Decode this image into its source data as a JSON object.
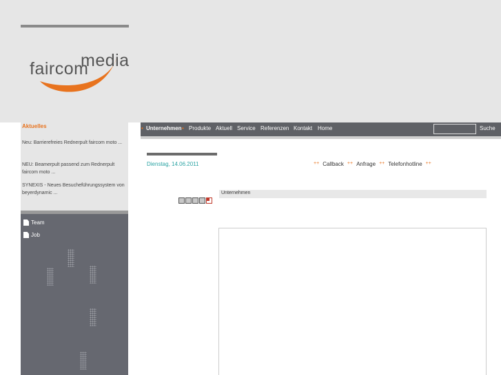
{
  "logo": {
    "line1": "media",
    "line2": "faircom",
    "accent_color": "#e8731e"
  },
  "news": {
    "title": "Aktuelles",
    "items": [
      "Neu: Barrierefreies Rednerpult faircom moto ...",
      "NEU: Beamerpult passend zum Rednerpult faircom moto ...",
      "SYNEXIS - Neues Besucheführungssystem von beyerdynamic ..."
    ]
  },
  "side_nav": [
    {
      "label": "Team",
      "icon": "document-icon"
    },
    {
      "label": "Job",
      "icon": "document-icon"
    }
  ],
  "main_nav": {
    "items": [
      "Unternehmen",
      "Produkte",
      "Aktuell",
      "Service",
      "Referenzen",
      "Kontakt",
      "Home"
    ],
    "active": "Unternehmen",
    "search_label": "Suche"
  },
  "date": "Dienstag, 14.06.2011",
  "quick_links": [
    "Callback",
    "Anfrage",
    "Telefonhotline"
  ],
  "arrows": "++",
  "section_title": "Unternehmen",
  "colors": {
    "accent": "#e8731e",
    "date": "#2aa3a3",
    "nav_bg": "#5f6166",
    "header_bg": "#e6e6e6"
  }
}
